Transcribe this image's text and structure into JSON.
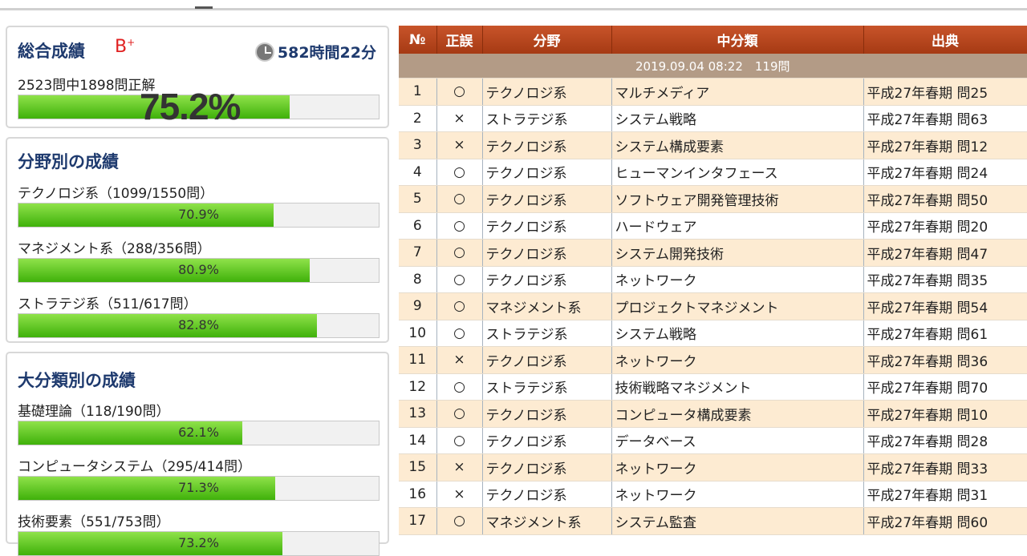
{
  "summary": {
    "title": "総合成績",
    "grade": "B",
    "grade_sup": "+",
    "time": "582時間22分",
    "count_text": "2523問中1898問正解",
    "percent_text": "75.2%",
    "percent": 75.2
  },
  "field_section": {
    "title": "分野別の成績",
    "items": [
      {
        "label": "テクノロジ系（1099/1550問）",
        "pct_text": "70.9%",
        "pct": 70.9
      },
      {
        "label": "マネジメント系（288/356問）",
        "pct_text": "80.9%",
        "pct": 80.9
      },
      {
        "label": "ストラテジ系（511/617問）",
        "pct_text": "82.8%",
        "pct": 82.8
      }
    ]
  },
  "major_section": {
    "title": "大分類別の成績",
    "items": [
      {
        "label": "基礎理論（118/190問）",
        "pct_text": "62.1%",
        "pct": 62.1
      },
      {
        "label": "コンピュータシステム（295/414問）",
        "pct_text": "71.3%",
        "pct": 71.3
      },
      {
        "label": "技術要素（551/753問）",
        "pct_text": "73.2%",
        "pct": 73.2
      }
    ]
  },
  "table": {
    "headers": [
      "№",
      "正誤",
      "分野",
      "中分類",
      "出典"
    ],
    "date_row": "2019.09.04 08:22　119問",
    "rows": [
      {
        "no": "1",
        "result": "○",
        "field": "テクノロジ系",
        "category": "マルチメディア",
        "source": "平成27年春期 問25"
      },
      {
        "no": "2",
        "result": "×",
        "field": "ストラテジ系",
        "category": "システム戦略",
        "source": "平成27年春期 問63"
      },
      {
        "no": "3",
        "result": "×",
        "field": "テクノロジ系",
        "category": "システム構成要素",
        "source": "平成27年春期 問12"
      },
      {
        "no": "4",
        "result": "○",
        "field": "テクノロジ系",
        "category": "ヒューマンインタフェース",
        "source": "平成27年春期 問24"
      },
      {
        "no": "5",
        "result": "○",
        "field": "テクノロジ系",
        "category": "ソフトウェア開発管理技術",
        "source": "平成27年春期 問50"
      },
      {
        "no": "6",
        "result": "○",
        "field": "テクノロジ系",
        "category": "ハードウェア",
        "source": "平成27年春期 問20"
      },
      {
        "no": "7",
        "result": "○",
        "field": "テクノロジ系",
        "category": "システム開発技術",
        "source": "平成27年春期 問47"
      },
      {
        "no": "8",
        "result": "○",
        "field": "テクノロジ系",
        "category": "ネットワーク",
        "source": "平成27年春期 問35"
      },
      {
        "no": "9",
        "result": "○",
        "field": "マネジメント系",
        "category": "プロジェクトマネジメント",
        "source": "平成27年春期 問54"
      },
      {
        "no": "10",
        "result": "○",
        "field": "ストラテジ系",
        "category": "システム戦略",
        "source": "平成27年春期 問61"
      },
      {
        "no": "11",
        "result": "×",
        "field": "テクノロジ系",
        "category": "ネットワーク",
        "source": "平成27年春期 問36"
      },
      {
        "no": "12",
        "result": "○",
        "field": "ストラテジ系",
        "category": "技術戦略マネジメント",
        "source": "平成27年春期 問70"
      },
      {
        "no": "13",
        "result": "○",
        "field": "テクノロジ系",
        "category": "コンピュータ構成要素",
        "source": "平成27年春期 問10"
      },
      {
        "no": "14",
        "result": "○",
        "field": "テクノロジ系",
        "category": "データベース",
        "source": "平成27年春期 問28"
      },
      {
        "no": "15",
        "result": "×",
        "field": "テクノロジ系",
        "category": "ネットワーク",
        "source": "平成27年春期 問33"
      },
      {
        "no": "16",
        "result": "×",
        "field": "テクノロジ系",
        "category": "ネットワーク",
        "source": "平成27年春期 問31"
      },
      {
        "no": "17",
        "result": "○",
        "field": "マネジメント系",
        "category": "システム監査",
        "source": "平成27年春期 問60"
      }
    ]
  }
}
